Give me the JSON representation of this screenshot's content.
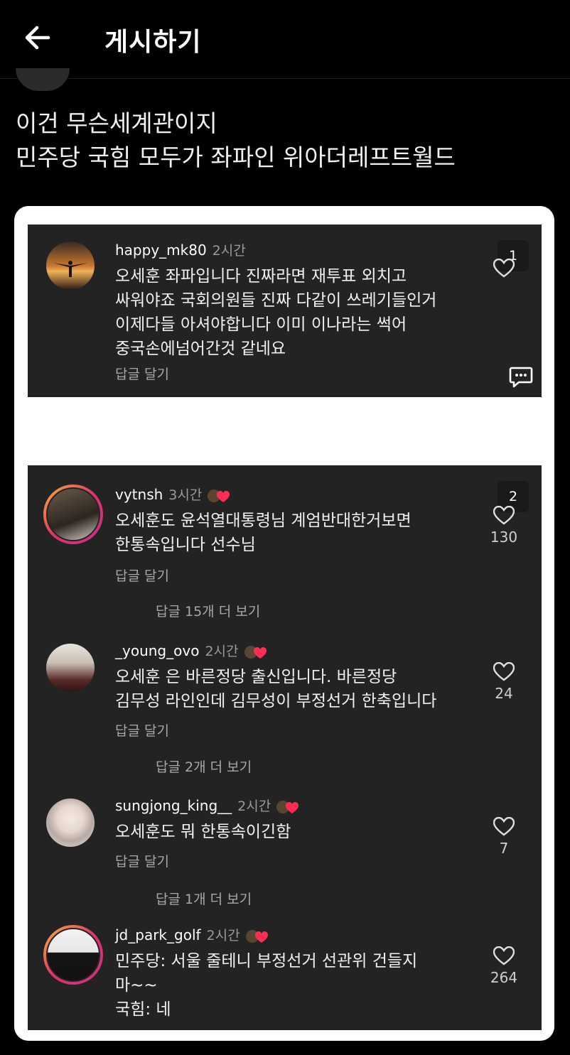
{
  "header": {
    "title": "게시하기"
  },
  "post": {
    "text": "이건 무슨세계관이지\n민주당 국힘 모두가 좌파인 위아더레프트월드"
  },
  "panel1": {
    "pin_number": "1",
    "comment": {
      "username": "happy_mk80",
      "time": "2시간",
      "text": "오세훈 좌파입니다 진짜라면 재투표 외치고\n싸워야죠 국회의원들 진짜 다같이 쓰레기들인거\n이제다들 아셔야합니다 이미 이나라는 썩어\n중국손에넘어간것 같네요",
      "reply_label": "답글 달기"
    }
  },
  "panel2": {
    "pin_number": "2",
    "comments": [
      {
        "username": "vytnsh",
        "time": "3시간",
        "text": "오세훈도 윤석열대통령님 계엄반대한거보면\n한통속입니다 선수님",
        "reply_label": "답글 달기",
        "likes": "130",
        "more_replies": "답글 15개 더 보기"
      },
      {
        "username": "_young_ovo",
        "time": "2시간",
        "text": "오세훈 은 바른정당 출신입니다. 바른정당\n김무성 라인인데 김무성이 부정선거 한축입니다",
        "reply_label": "답글 달기",
        "likes": "24",
        "more_replies": "답글 2개 더 보기"
      },
      {
        "username": "sungjong_king__",
        "time": "2시간",
        "text": "오세훈도 뭐 한통속이긴함",
        "reply_label": "답글 달기",
        "likes": "7",
        "more_replies": "답글 1개 더 보기"
      },
      {
        "username": "jd_park_golf",
        "time": "2시간",
        "text": "민주당: 서울 줄테니 부정선거 선관위 건들지\n마~~\n국힘: 네",
        "likes": "264"
      }
    ]
  },
  "colors": {
    "background": "#000000",
    "panel": "#232323",
    "card": "#ffffff",
    "badge_heart": "#ff2d55"
  }
}
